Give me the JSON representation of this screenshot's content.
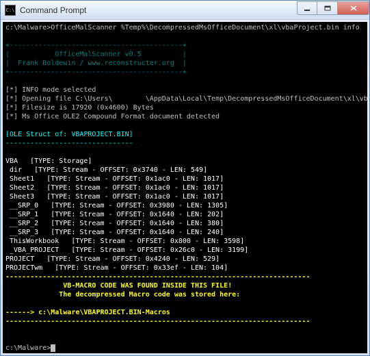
{
  "window": {
    "title": "Command Prompt",
    "icon": "C:\\"
  },
  "prompt": {
    "path": "c:\\Malware>",
    "command": "OfficeMalScanner %Temp%\\DecompressedMsOfficeDocument\\xl\\vbaProject.bin info"
  },
  "banner": {
    "top": "+------------------------------------------+",
    "line1": "|           OfficeMalScanner v0.5          |",
    "line2": "|  Frank Boldewin / www.reconstructer.org  |",
    "bottom": "+------------------------------------------+"
  },
  "info": {
    "l1": "[*] INFO mode selected",
    "l2a": "[*] Opening file C:\\Users\\",
    "l2b": "\\AppData\\Local\\Temp\\DecompressedMsOfficeDocument\\xl\\vbaProject.bin",
    "l3": "[*] Filesize is 17920 (0x4600) Bytes",
    "l4": "[*] Ms Office OLE2 Compound Format document detected"
  },
  "ole": {
    "header": "[OLE Struct of: VBAPROJECT.BIN]",
    "sep": "-------------------------------"
  },
  "streams": {
    "l0": "VBA   [TYPE: Storage]",
    "l1": " dir   [TYPE: Stream - OFFSET: 0x3740 - LEN: 549]",
    "l2": " Sheet1   [TYPE: Stream - OFFSET: 0x1ac0 - LEN: 1017]",
    "l3": " Sheet2   [TYPE: Stream - OFFSET: 0x1ac0 - LEN: 1017]",
    "l4": " Sheet3   [TYPE: Stream - OFFSET: 0x1ac0 - LEN: 1017]",
    "l5": " __SRP_0   [TYPE: Stream - OFFSET: 0x3980 - LEN: 1305]",
    "l6": " __SRP_1   [TYPE: Stream - OFFSET: 0x1640 - LEN: 202]",
    "l7": " __SRP_2   [TYPE: Stream - OFFSET: 0x1640 - LEN: 380]",
    "l8": " __SRP_3   [TYPE: Stream - OFFSET: 0x1640 - LEN: 240]",
    "l9": " ThisWorkbook   [TYPE: Stream - OFFSET: 0x800 - LEN: 3598]",
    "l10": " _VBA_PROJECT   [TYPE: Stream - OFFSET: 0x26c0 - LEN: 3199]",
    "l11": "PROJECT   [TYPE: Stream - OFFSET: 0x4240 - LEN: 529]",
    "l12": "PROJECTwm   [TYPE: Stream - OFFSET: 0x33ef - LEN: 104]"
  },
  "result": {
    "sep_top": "--------------------------------------------------------------------------",
    "msg1": "              VB-MACRO CODE WAS FOUND INSIDE THIS FILE!",
    "msg2": "             The decompressed Macro code was stored here:",
    "arrow": "------> c:\\Malware\\VBAPROJECT.BIN-Macros",
    "sep_bot": "--------------------------------------------------------------------------"
  },
  "final_prompt": "c:\\Malware>"
}
